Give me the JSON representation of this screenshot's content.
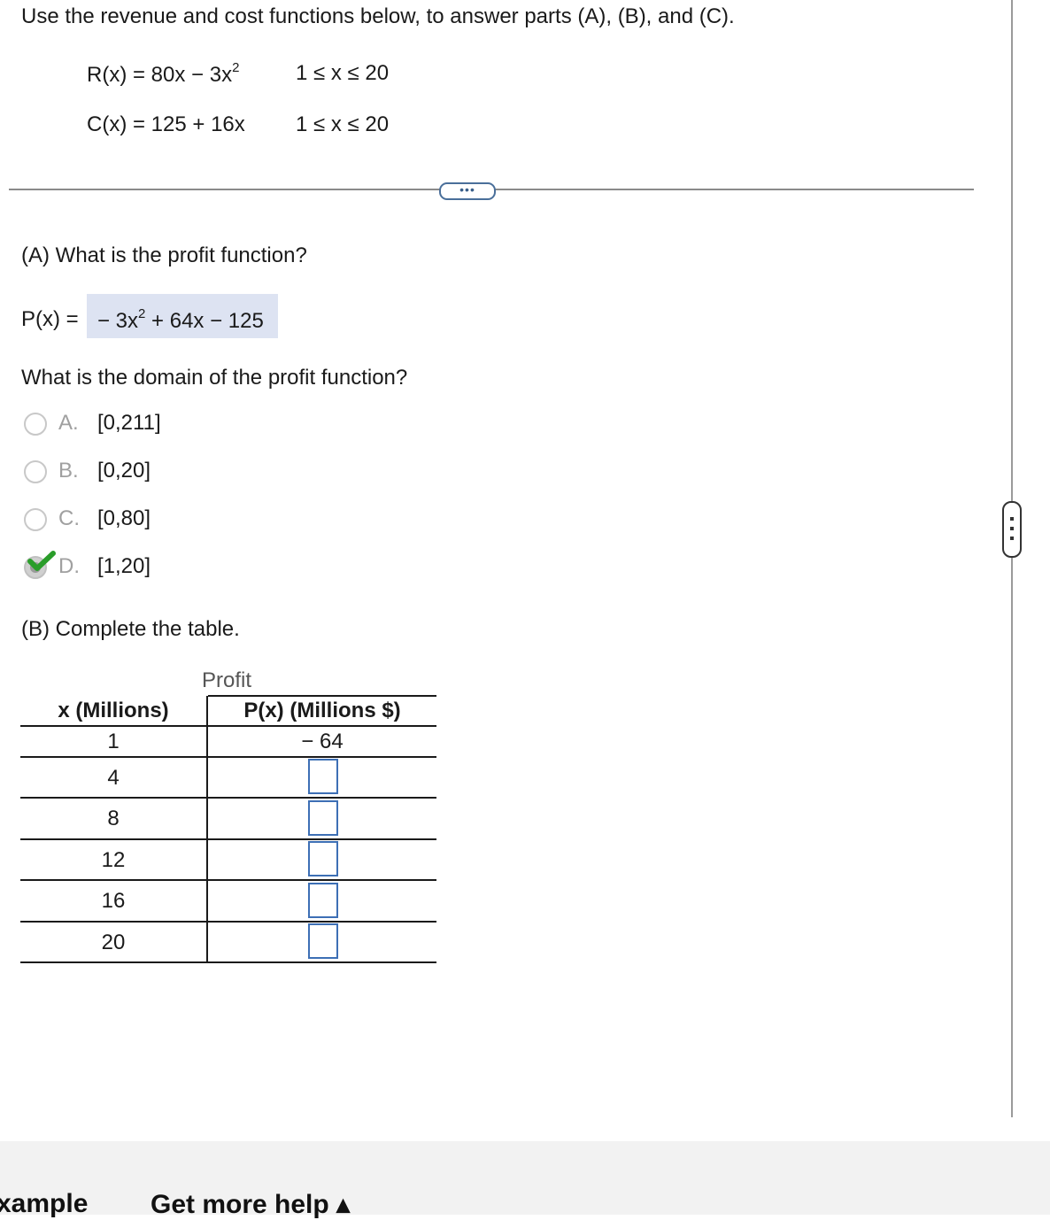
{
  "instructions": "Use the revenue and cost functions below, to answer parts (A), (B), and (C).",
  "revenue": {
    "label": "R(x) = 80x − 3x",
    "exp": "2",
    "domain": "1 ≤ x ≤ 20"
  },
  "cost": {
    "label": "C(x) = 125 + 16x",
    "domain": "1 ≤ x ≤ 20"
  },
  "more_button_label": "•••",
  "partA": {
    "question": "(A) What is the profit function?",
    "answer_prefix": "P(x) =",
    "answer_lead": "− 3x",
    "answer_exp": "2",
    "answer_tail": " + 64x − 125",
    "domain_question": "What is the domain of the profit function?",
    "options": [
      {
        "letter": "A.",
        "text": "[0,211]",
        "selected": false
      },
      {
        "letter": "B.",
        "text": "[0,20]",
        "selected": false
      },
      {
        "letter": "C.",
        "text": "[0,80]",
        "selected": false
      },
      {
        "letter": "D.",
        "text": "[1,20]",
        "selected": true
      }
    ]
  },
  "partB": {
    "prompt": "(B) Complete the table.",
    "group_header": "Profit",
    "col_x": "x (Millions)",
    "col_p": "P(x) (Millions $)",
    "rows": [
      {
        "x": "1",
        "p": "− 64"
      },
      {
        "x": "4",
        "p": ""
      },
      {
        "x": "8",
        "p": ""
      },
      {
        "x": "12",
        "p": ""
      },
      {
        "x": "16",
        "p": ""
      },
      {
        "x": "20",
        "p": ""
      }
    ]
  },
  "footer": {
    "example_label": "xample",
    "help_label": "Get more help ▴"
  }
}
